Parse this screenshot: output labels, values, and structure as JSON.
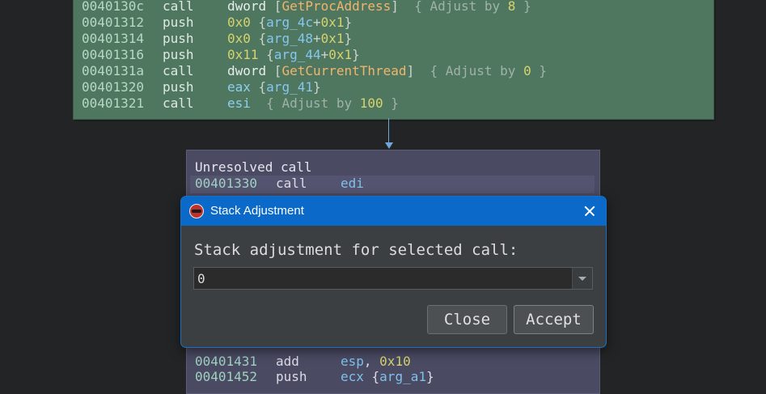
{
  "top_block": {
    "rows": [
      {
        "addr": "0040130c",
        "mn": "call",
        "tokens": [
          [
            "t-plain",
            "dword "
          ],
          [
            "t-br",
            "["
          ],
          [
            "t-sym",
            "GetProcAddress"
          ],
          [
            "t-br",
            "]"
          ],
          [
            "t-cmt",
            "  { Adjust by "
          ],
          [
            "t-num",
            "8"
          ],
          [
            "t-cmt",
            " }"
          ]
        ]
      },
      {
        "addr": "00401312",
        "mn": "push",
        "tokens": [
          [
            "t-num",
            "0x0"
          ],
          [
            "t-br",
            " {"
          ],
          [
            "t-arg",
            "arg_4c"
          ],
          [
            "t-br",
            "+"
          ],
          [
            "t-num",
            "0x1"
          ],
          [
            "t-br",
            "}"
          ]
        ]
      },
      {
        "addr": "00401314",
        "mn": "push",
        "tokens": [
          [
            "t-num",
            "0x0"
          ],
          [
            "t-br",
            " {"
          ],
          [
            "t-arg",
            "arg_48"
          ],
          [
            "t-br",
            "+"
          ],
          [
            "t-num",
            "0x1"
          ],
          [
            "t-br",
            "}"
          ]
        ]
      },
      {
        "addr": "00401316",
        "mn": "push",
        "tokens": [
          [
            "t-num",
            "0x11"
          ],
          [
            "t-br",
            " {"
          ],
          [
            "t-arg",
            "arg_44"
          ],
          [
            "t-br",
            "+"
          ],
          [
            "t-num",
            "0x1"
          ],
          [
            "t-br",
            "}"
          ]
        ]
      },
      {
        "addr": "0040131a",
        "mn": "call",
        "tokens": [
          [
            "t-plain",
            "dword "
          ],
          [
            "t-br",
            "["
          ],
          [
            "t-sym",
            "GetCurrentThread"
          ],
          [
            "t-br",
            "]"
          ],
          [
            "t-cmt",
            "  { Adjust by "
          ],
          [
            "t-num",
            "0"
          ],
          [
            "t-cmt",
            " }"
          ]
        ]
      },
      {
        "addr": "00401320",
        "mn": "push",
        "tokens": [
          [
            "t-reg",
            "eax"
          ],
          [
            "t-br",
            " {"
          ],
          [
            "t-arg",
            "arg_41"
          ],
          [
            "t-br",
            "}"
          ]
        ]
      },
      {
        "addr": "00401321",
        "mn": "call",
        "tokens": [
          [
            "t-reg",
            "esi"
          ],
          [
            "t-cmt",
            "  { Adjust by "
          ],
          [
            "t-num",
            "100"
          ],
          [
            "t-cmt",
            " }"
          ]
        ]
      }
    ]
  },
  "bottom_block": {
    "title": "Unresolved call",
    "rows_top": [
      {
        "addr": "00401330",
        "mn": "call",
        "tokens": [
          [
            "b-reg",
            "edi"
          ]
        ]
      }
    ],
    "rows_bottom": [
      {
        "addr": "00401431",
        "mn": "add",
        "tokens": [
          [
            "b-reg",
            "esp"
          ],
          [
            "b-plain",
            ", "
          ],
          [
            "b-num",
            "0x10"
          ]
        ]
      },
      {
        "addr": "00401452",
        "mn": "push",
        "tokens": [
          [
            "b-reg",
            "ecx"
          ],
          [
            "b-plain",
            " {"
          ],
          [
            "b-reg",
            "arg_a1"
          ],
          [
            "b-plain",
            "}"
          ]
        ]
      }
    ]
  },
  "dialog": {
    "title": "Stack Adjustment",
    "prompt": "Stack adjustment for selected call:",
    "value": "0",
    "close_label": "Close",
    "accept_label": "Accept",
    "icons": {
      "app": "app-icon",
      "close": "close-icon",
      "dropdown": "chevron-down-icon"
    }
  },
  "colors": {
    "top_block_bg": "#4f7760",
    "bottom_block_bg": "#4a4a63",
    "titlebar": "#0a69c9",
    "dialog_bg": "#3c3f41",
    "arrow": "#6fa8d8"
  }
}
